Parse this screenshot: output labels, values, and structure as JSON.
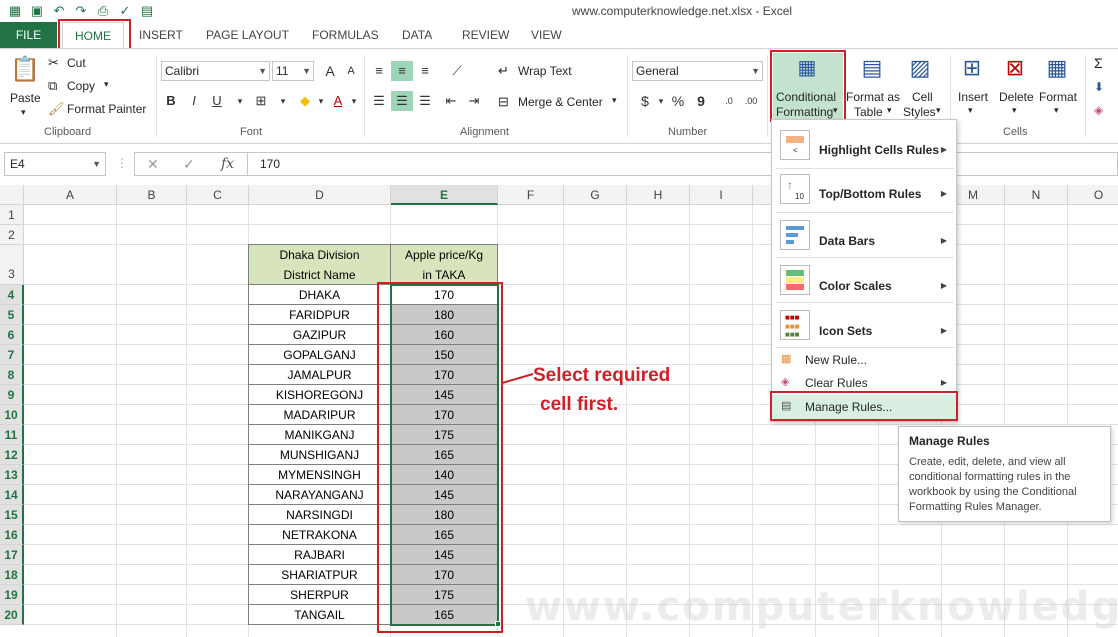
{
  "window": {
    "title": "www.computerknowledge.net.xlsx - Excel"
  },
  "tabs": [
    "FILE",
    "HOME",
    "INSERT",
    "PAGE LAYOUT",
    "FORMULAS",
    "DATA",
    "REVIEW",
    "VIEW"
  ],
  "ribbon": {
    "clipboard": {
      "paste": "Paste",
      "cut": "Cut",
      "copy": "Copy",
      "format_painter": "Format Painter",
      "label": "Clipboard"
    },
    "font": {
      "family": "Calibri",
      "size": "11",
      "bold": "B",
      "italic": "I",
      "underline": "U",
      "label": "Font"
    },
    "alignment": {
      "wrap_text": "Wrap Text",
      "merge_center": "Merge & Center",
      "label": "Alignment"
    },
    "number": {
      "format": "General",
      "currency": "$",
      "percent": "%",
      "comma": "9",
      "label": "Number"
    },
    "styles": {
      "conditional_formatting_1": "Conditional",
      "conditional_formatting_2": "Formatting",
      "format_as_table_1": "Format as",
      "format_as_table_2": "Table",
      "cell_styles_1": "Cell",
      "cell_styles_2": "Styles"
    },
    "cells": {
      "insert": "Insert",
      "delete": "Delete",
      "format": "Format",
      "label": "Cells"
    }
  },
  "formula_bar": {
    "name_box": "E4",
    "fx": "fx",
    "value": "170"
  },
  "columns": [
    "A",
    "B",
    "C",
    "D",
    "E",
    "F",
    "G",
    "H",
    "I",
    "J",
    "K",
    "L",
    "M",
    "N",
    "O"
  ],
  "rows": [
    "1",
    "2",
    "3",
    "4",
    "5",
    "6",
    "7",
    "8",
    "9",
    "10",
    "11",
    "12",
    "13",
    "14",
    "15",
    "16",
    "17",
    "18",
    "19",
    "20"
  ],
  "table": {
    "header_district_1": "Dhaka Division",
    "header_district_2": "District Name",
    "header_price_1": "Apple price/Kg",
    "header_price_2": "in TAKA",
    "rows": [
      {
        "district": "DHAKA",
        "price": "170"
      },
      {
        "district": "FARIDPUR",
        "price": "180"
      },
      {
        "district": "GAZIPUR",
        "price": "160"
      },
      {
        "district": "GOPALGANJ",
        "price": "150"
      },
      {
        "district": "JAMALPUR",
        "price": "170"
      },
      {
        "district": "KISHOREGONJ",
        "price": "145"
      },
      {
        "district": "MADARIPUR",
        "price": "170"
      },
      {
        "district": "MANIKGANJ",
        "price": "175"
      },
      {
        "district": "MUNSHIGANJ",
        "price": "165"
      },
      {
        "district": "MYMENSINGH",
        "price": "140"
      },
      {
        "district": "NARAYANGANJ",
        "price": "145"
      },
      {
        "district": "NARSINGDI",
        "price": "180"
      },
      {
        "district": "NETRAKONA",
        "price": "165"
      },
      {
        "district": "RAJBARI",
        "price": "145"
      },
      {
        "district": "SHARIATPUR",
        "price": "170"
      },
      {
        "district": "SHERPUR",
        "price": "175"
      },
      {
        "district": "TANGAIL",
        "price": "165"
      }
    ]
  },
  "annotation": {
    "line1": "Select required",
    "line2": "cell first."
  },
  "cf_menu": {
    "highlight": "Highlight Cells Rules",
    "topbottom": "Top/Bottom Rules",
    "databars": "Data Bars",
    "colorscales": "Color Scales",
    "iconsets": "Icon Sets",
    "newrule": "New Rule...",
    "clearrules": "Clear Rules",
    "managerules": "Manage Rules..."
  },
  "tooltip": {
    "title": "Manage Rules",
    "desc": "Create, edit, delete, and view all conditional formatting rules in the workbook by using the Conditional Formatting Rules Manager."
  },
  "watermark": "www.computerknowledge.net",
  "colors": {
    "excel_green": "#217346",
    "highlight_red": "#d11f26",
    "header_fill": "#d8e4bc",
    "selection_fill": "#c9c9c9"
  }
}
